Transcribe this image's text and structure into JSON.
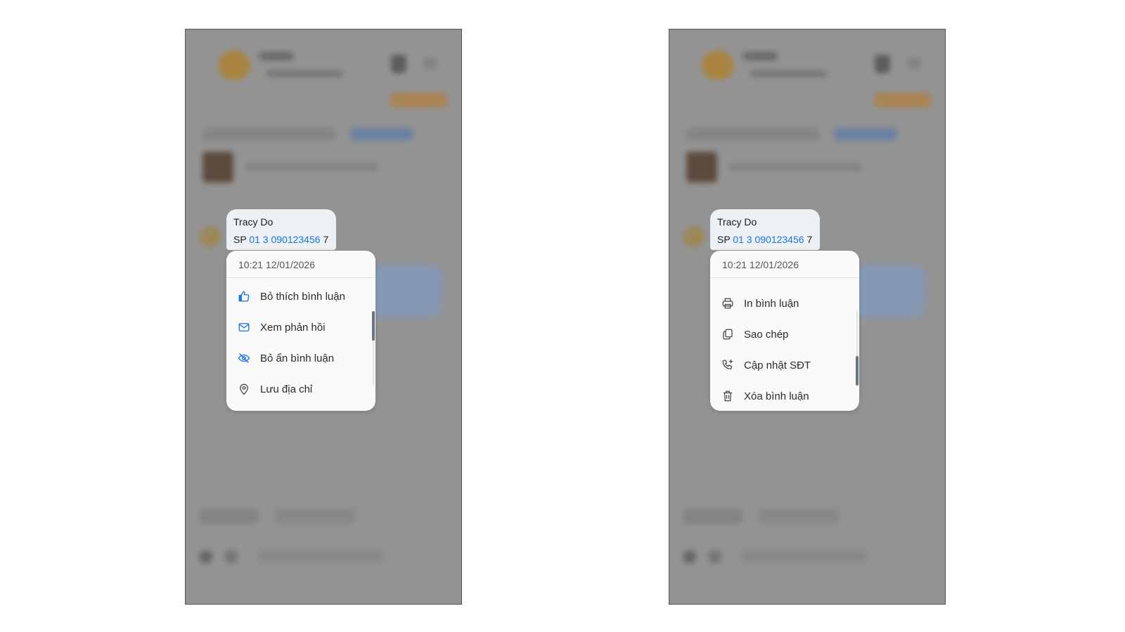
{
  "screens": [
    {
      "comment": {
        "author": "Tracy Do",
        "prefix": "SP",
        "phone": "01 3 090123456",
        "suffix": "7"
      },
      "menu": {
        "timestamp": "10:21 12/01/2026",
        "items": [
          {
            "icon": "thumbs-up-icon",
            "label": "Bỏ thích bình luận",
            "color": "#1a73e8"
          },
          {
            "icon": "envelope-icon",
            "label": "Xem phản hồi",
            "color": "#1a73e8"
          },
          {
            "icon": "eye-off-icon",
            "label": "Bỏ ẩn bình luận",
            "color": "#1a73e8"
          },
          {
            "icon": "location-pin-icon",
            "label": "Lưu địa chỉ",
            "color": "#444444"
          }
        ],
        "scroll_position": "middle"
      }
    },
    {
      "comment": {
        "author": "Tracy Do",
        "prefix": "SP",
        "phone": "01 3 090123456",
        "suffix": "7"
      },
      "menu": {
        "timestamp": "10:21 12/01/2026",
        "items": [
          {
            "icon": "printer-icon",
            "label": "In bình luận",
            "color": "#444444"
          },
          {
            "icon": "copy-icon",
            "label": "Sao chép",
            "color": "#444444"
          },
          {
            "icon": "phone-plus-icon",
            "label": "Cập nhật SĐT",
            "color": "#444444"
          },
          {
            "icon": "trash-icon",
            "label": "Xóa bình luận",
            "color": "#444444"
          }
        ],
        "scroll_position": "bottom"
      }
    }
  ],
  "colors": {
    "link": "#1a73e8",
    "backdrop": "#9d9d9d",
    "menu_bg": "#fafafa",
    "bubble_bg": "#eef1f4"
  }
}
